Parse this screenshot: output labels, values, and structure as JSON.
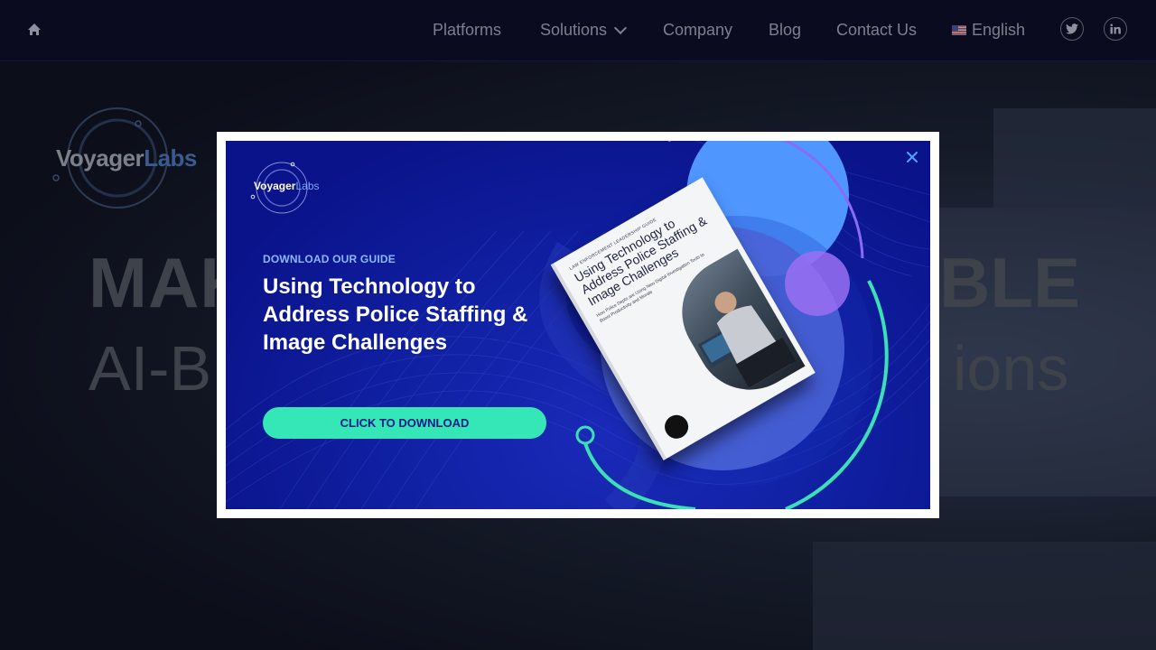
{
  "nav": {
    "items": [
      {
        "label": "Platforms"
      },
      {
        "label": "Solutions"
      },
      {
        "label": "Company"
      },
      {
        "label": "Blog"
      },
      {
        "label": "Contact Us"
      }
    ],
    "language": "English",
    "icons": [
      "home-icon",
      "twitter-icon",
      "linkedin-icon",
      "us-flag-icon",
      "chevron-down-icon"
    ]
  },
  "background": {
    "logo_voyager": "Voyager",
    "logo_labs": "Labs",
    "heading_left": "MAK",
    "heading_right": "BLE",
    "subheading_left": "AI-B",
    "subheading_right": "ions"
  },
  "modal": {
    "logo_voyager": "Voyager",
    "logo_labs": "Labs",
    "eyebrow": "DOWNLOAD OUR GUIDE",
    "headline": "Using Technology to Address Police Staffing & Image Challenges",
    "cta_label": "CLICK TO DOWNLOAD",
    "close_icon": "close-icon",
    "book": {
      "eyebrow": "LAW ENFORCEMENT LEADERSHIP GUIDE",
      "title": "Using Technology to Address Police Staffing & Image Challenges",
      "subtitle": "How Police Depts are Using New Digital Investigation Tools to Boost Productivity and Morale"
    }
  },
  "colors": {
    "modal_bg": "#1122a6",
    "cta": "#35e6b7",
    "eyebrow": "#8fb7ff",
    "accent_ring": "#3be0b5",
    "purple_ring": "#8a6bf5",
    "light_blue_circle": "#4f96ff"
  }
}
